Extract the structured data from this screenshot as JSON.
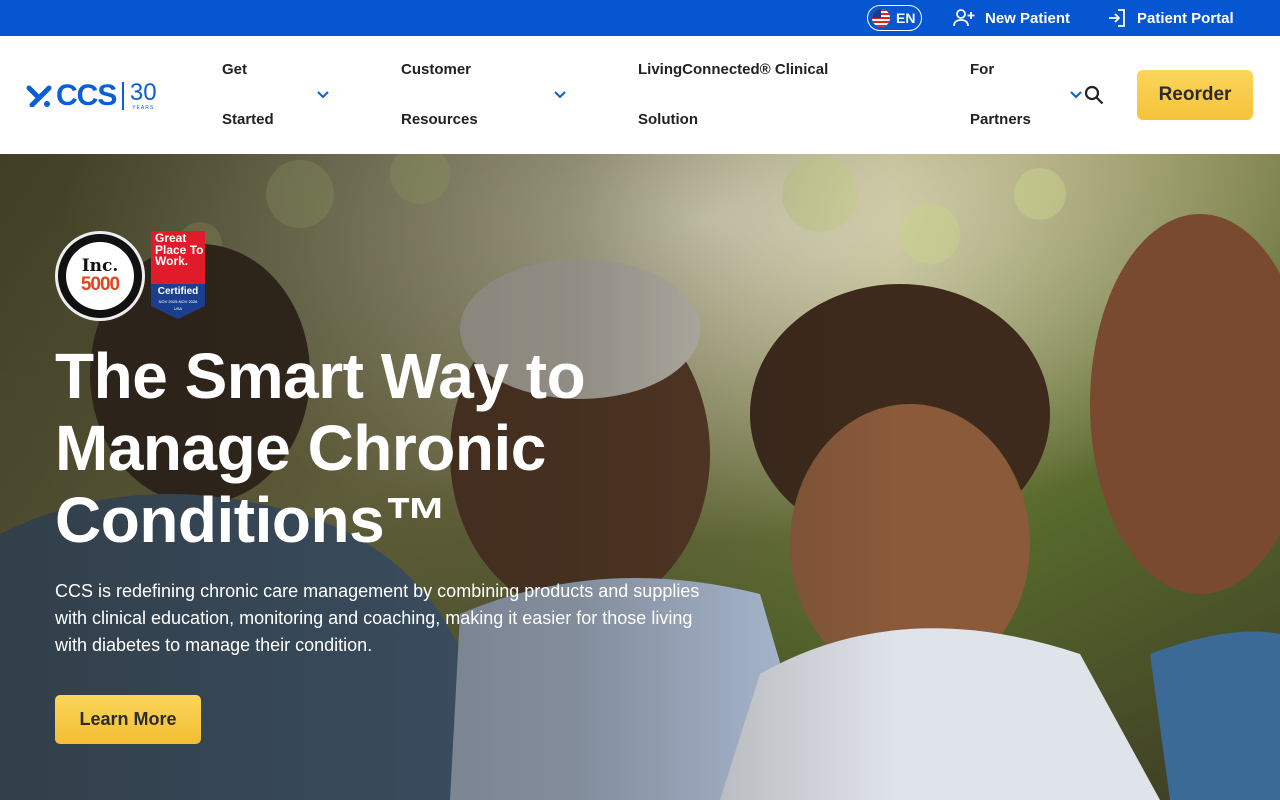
{
  "topbar": {
    "language": "EN",
    "new_patient": "New Patient",
    "patient_portal": "Patient Portal"
  },
  "header": {
    "logo_text": "CCS",
    "logo_years": "30",
    "logo_years_label": "YEARS",
    "nav": [
      {
        "line1": "Get",
        "line2": "Started"
      },
      {
        "line1": "Customer",
        "line2": "Resources"
      },
      {
        "line1": "LivingConnected® Clinical",
        "line2": "Solution"
      },
      {
        "line1": "For",
        "line2": "Partners"
      }
    ],
    "reorder_label": "Reorder"
  },
  "hero": {
    "badge_inc_top": "Inc.",
    "badge_inc_number": "5000",
    "badge_gptw_text": "Great Place To Work.",
    "badge_gptw_certified": "Certified",
    "badge_gptw_dates": "NOV 2025-NOV 2026",
    "badge_gptw_country": "USA",
    "title": "The Smart Way to Manage Chronic Conditions™",
    "description": "CCS is redefining chronic care management by combining products and supplies with clinical education, monitoring and coaching, making it easier for those living with diabetes to manage their condition.",
    "cta_label": "Learn More"
  },
  "colors": {
    "brand_blue": "#0655d1",
    "accent_yellow": "#f5c23a"
  }
}
